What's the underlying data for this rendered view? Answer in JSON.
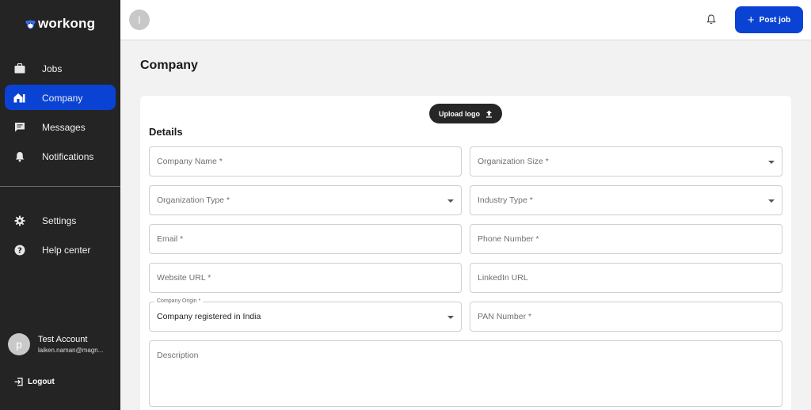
{
  "brand": {
    "name": "workong"
  },
  "sidebar": {
    "items": [
      {
        "label": "Jobs",
        "icon": "briefcase-icon",
        "active": false
      },
      {
        "label": "Company",
        "icon": "company-icon",
        "active": true
      },
      {
        "label": "Messages",
        "icon": "message-icon",
        "active": false
      },
      {
        "label": "Notifications",
        "icon": "bell-icon",
        "active": false
      }
    ],
    "bottom_items": [
      {
        "label": "Settings",
        "icon": "gear-icon"
      },
      {
        "label": "Help center",
        "icon": "help-icon"
      }
    ],
    "account": {
      "initial": "p",
      "name": "Test Account",
      "email": "laiken.naman@magn..."
    },
    "logout_label": "Logout"
  },
  "topbar": {
    "avatar_initial": "l",
    "post_job_label": "Post job"
  },
  "page": {
    "title": "Company",
    "upload_logo_label": "Upload logo",
    "section_title": "Details",
    "fields": {
      "company_name": "Company Name *",
      "organization_size": "Organization Size *",
      "organization_type": "Organization Type *",
      "industry_type": "Industry Type *",
      "email": "Email *",
      "phone_number": "Phone Number *",
      "website_url": "Website URL *",
      "linkedin_url": "LinkedIn URL",
      "company_origin_label": "Company Origin *",
      "company_origin_value": "Company registered in India",
      "pan_number": "PAN Number *",
      "description": "Description"
    }
  },
  "colors": {
    "accent": "#0a43d4",
    "sidebar_bg": "#242424"
  }
}
